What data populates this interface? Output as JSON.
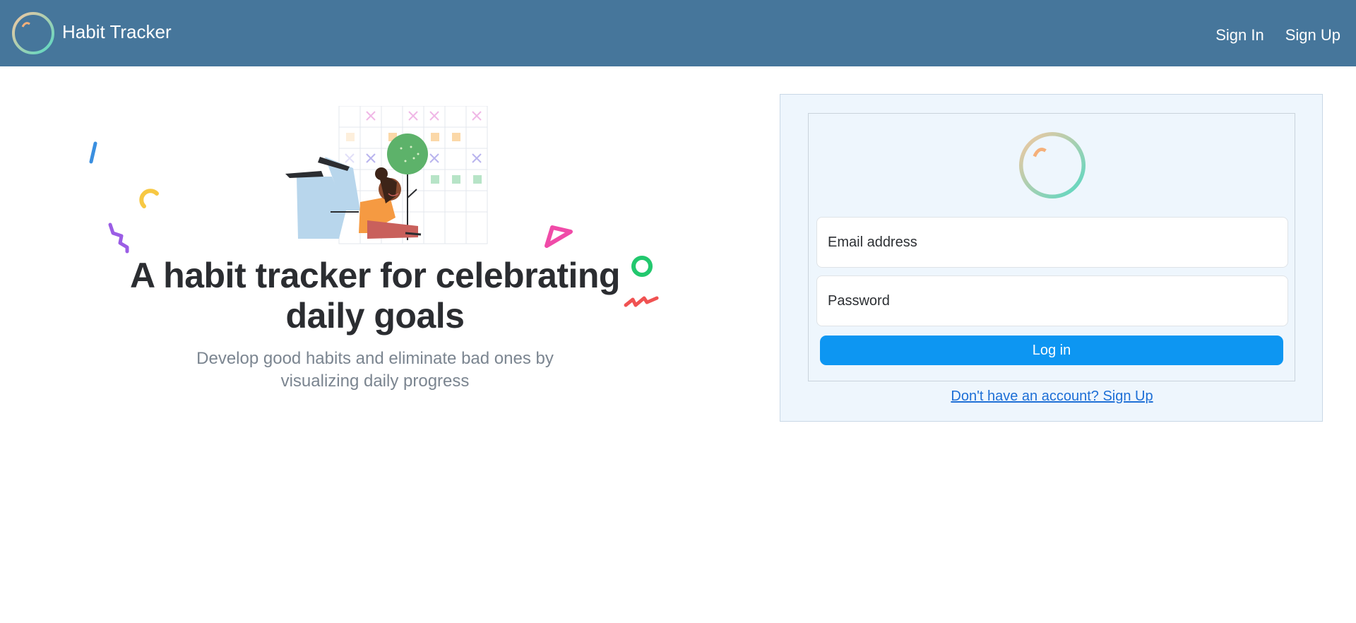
{
  "navbar": {
    "brand_name": "Habit Tracker",
    "brand_logo_icon": "habit-tracker-logo-icon",
    "links": {
      "sign_in": "Sign In",
      "sign_up": "Sign Up"
    },
    "background_color": "#46769b"
  },
  "hero": {
    "title": "A habit tracker for celebrating daily goals",
    "subtitle": "Develop good habits and eliminate bad ones by visualizing daily progress",
    "illustration_icon": "person-with-habit-grid-illustration"
  },
  "login": {
    "logo_icon": "habit-tracker-logo-icon",
    "email_placeholder": "Email address",
    "password_placeholder": "Password",
    "submit_label": "Log in",
    "signup_link": "Don't have an account? Sign Up",
    "button_color": "#0d96f2"
  }
}
